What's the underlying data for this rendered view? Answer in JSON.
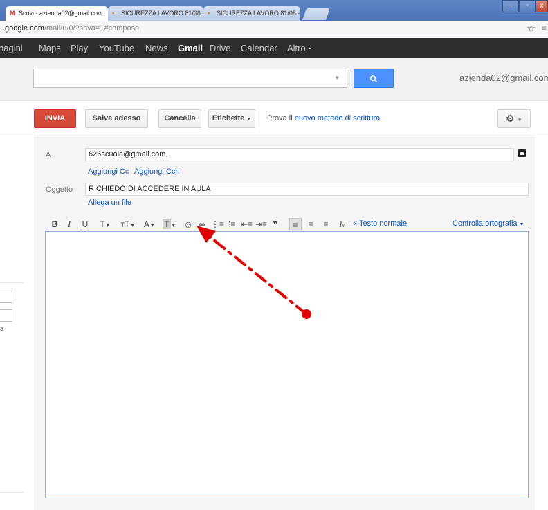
{
  "browser": {
    "tabs": [
      {
        "icon": "gmail-icon",
        "title": "Scrivi - azienda02@gmail.com",
        "active": true
      },
      {
        "icon": "folder-icon",
        "title": "SICUREZZA LAVORO 81/08 -",
        "active": false
      },
      {
        "icon": "folder-icon",
        "title": "SICUREZZA LAVORO 81/08 -",
        "active": false
      }
    ],
    "url_host": ".google.com",
    "url_rest": "/mail/u/0/?shva=1#compose"
  },
  "gbar": {
    "items": [
      "nagini",
      "Maps",
      "Play",
      "YouTube",
      "News",
      "Gmail",
      "Drive",
      "Calendar",
      "Altro -"
    ]
  },
  "header": {
    "search_placeholder": "",
    "search_button_icon": "search-icon",
    "account": "azienda02@gmail.com"
  },
  "actions": {
    "send": "INVIA",
    "save": "Salva adesso",
    "discard": "Cancella",
    "labels": "Etichette",
    "prova_prefix": "Prova il",
    "prova_link": "nuovo metodo di scrittura",
    "prova_suffix": "."
  },
  "compose": {
    "to_label": "A",
    "to_value": "626scuola@gmail.com,",
    "add_cc": "Aggiungi Cc",
    "add_bcc": "Aggiungi Ccn",
    "subject_label": "Oggetto",
    "subject_value": "RICHIEDO DI ACCEDERE IN AULA",
    "attach": "Allega un file",
    "plain_text": "« Testo normale",
    "spellcheck": "Controlla ortografia"
  },
  "left_nav": {
    "fragment": "a"
  },
  "colors": {
    "send_button": "#d14836",
    "search_button": "#4d90fe",
    "link": "#1155cc",
    "annotation": "#e00000"
  }
}
